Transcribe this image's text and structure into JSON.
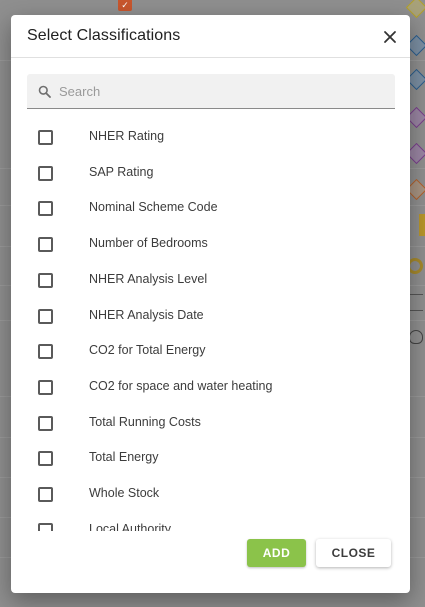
{
  "dialog": {
    "title": "Select Classifications",
    "close_icon": "close-icon"
  },
  "search": {
    "placeholder": "Search",
    "value": ""
  },
  "items": [
    {
      "label": "NHER Rating",
      "checked": false
    },
    {
      "label": "SAP Rating",
      "checked": false
    },
    {
      "label": "Nominal Scheme Code",
      "checked": false
    },
    {
      "label": "Number of Bedrooms",
      "checked": false
    },
    {
      "label": "NHER Analysis Level",
      "checked": false
    },
    {
      "label": "NHER Analysis Date",
      "checked": false
    },
    {
      "label": "CO2 for Total Energy",
      "checked": false
    },
    {
      "label": "CO2 for space and water heating",
      "checked": false
    },
    {
      "label": "Total Running Costs",
      "checked": false
    },
    {
      "label": "Total Energy",
      "checked": false
    },
    {
      "label": "Whole Stock",
      "checked": false
    },
    {
      "label": "Local Authority",
      "checked": false
    }
  ],
  "buttons": {
    "add_label": "ADD",
    "close_label": "CLOSE"
  },
  "colors": {
    "add_button": "#8bc34a",
    "overlay": "#8f8f8f"
  }
}
